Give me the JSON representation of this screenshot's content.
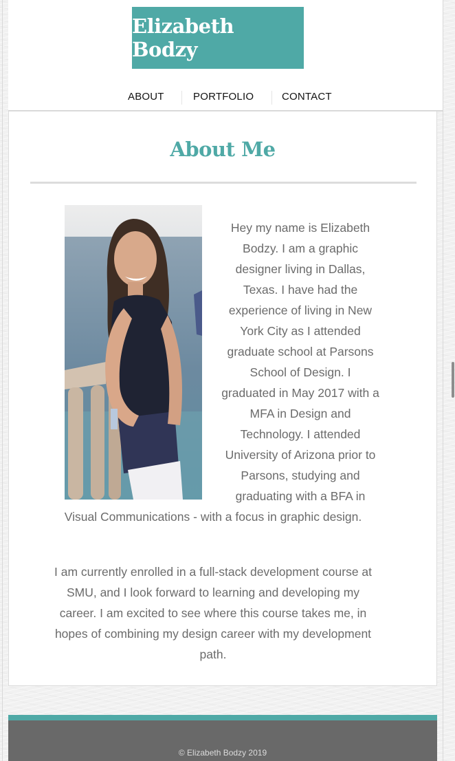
{
  "site": {
    "logo_text": "Elizabeth Bodzy"
  },
  "nav": {
    "items": [
      {
        "label": "ABOUT"
      },
      {
        "label": "PORTFOLIO"
      },
      {
        "label": "CONTACT"
      }
    ]
  },
  "main": {
    "heading": "About Me",
    "photo_alt": "Photo of Elizabeth Bodzy",
    "bio_lines": [
      "Hey my name is Elizabeth",
      "Bodzy. I am a graphic",
      "designer living in Dallas,",
      "Texas. I have had the",
      "experience of living in New",
      "York City as I attended",
      "graduate school at Parsons",
      "School of Design. I",
      "graduated in May 2017 with a",
      "MFA in Design and",
      "Technology. I attended",
      "University of Arizona prior to",
      "Parsons, studying and",
      "graduating with a BFA in",
      "Visual Communications - with a focus in graphic design."
    ],
    "second_lines": [
      "I am currently enrolled in a full-stack development course at",
      "SMU, and I look forward to learning and developing my",
      "career. I am excited to see where this course takes me, in",
      "hopes of combining my design career with my development",
      "path."
    ]
  },
  "footer": {
    "copyright": "© Elizabeth Bodzy 2019"
  },
  "colors": {
    "accent": "#4fa9a6",
    "footer_bg": "#696969",
    "body_text": "#6b6b6b"
  }
}
